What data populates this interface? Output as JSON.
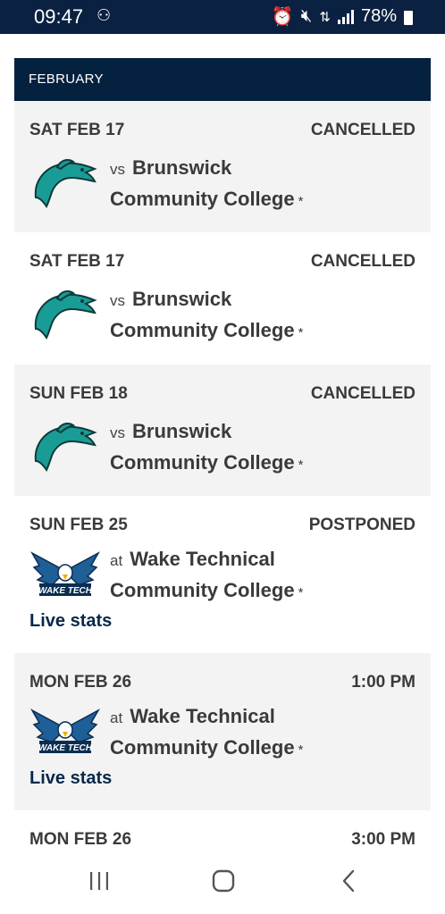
{
  "status_bar": {
    "time": "09:47",
    "battery": "78%",
    "icons": [
      "usb-icon",
      "alarm-icon",
      "mute-icon",
      "data-icon",
      "signal-icon",
      "battery-icon"
    ]
  },
  "schedule": {
    "month": "FEBRUARY",
    "games": [
      {
        "date": "SAT FEB 17",
        "status": "CANCELLED",
        "prep": "vs",
        "opponent_line1": "Brunswick",
        "opponent_line2": "Community College",
        "asterisk": "*",
        "logo": "dolphin-logo",
        "live_stats": ""
      },
      {
        "date": "SAT FEB 17",
        "status": "CANCELLED",
        "prep": "vs",
        "opponent_line1": "Brunswick",
        "opponent_line2": "Community College",
        "asterisk": "*",
        "logo": "dolphin-logo",
        "live_stats": ""
      },
      {
        "date": "SUN FEB 18",
        "status": "CANCELLED",
        "prep": "vs",
        "opponent_line1": "Brunswick",
        "opponent_line2": "Community College",
        "asterisk": "*",
        "logo": "dolphin-logo",
        "live_stats": ""
      },
      {
        "date": "SUN FEB 25",
        "status": "POSTPONED",
        "prep": "at",
        "opponent_line1": "Wake Technical",
        "opponent_line2": "Community College",
        "asterisk": "*",
        "logo": "wake-tech-eagle-logo",
        "live_stats": "Live stats"
      },
      {
        "date": "MON FEB 26",
        "status": "1:00 PM",
        "prep": "at",
        "opponent_line1": "Wake Technical",
        "opponent_line2": "Community College",
        "asterisk": "*",
        "logo": "wake-tech-eagle-logo",
        "live_stats": "Live stats"
      },
      {
        "date": "MON FEB 26",
        "status": "3:00 PM"
      }
    ]
  },
  "logo_text": {
    "wake_tech": "WAKE TECH"
  },
  "nav_bar": {
    "icons": [
      "recent-apps-icon",
      "home-icon",
      "back-icon"
    ]
  },
  "colors": {
    "header_navy": "#04213f",
    "teal": "#1a9c96",
    "row_gray": "#f3f3f3",
    "text": "#3a3a3a"
  }
}
